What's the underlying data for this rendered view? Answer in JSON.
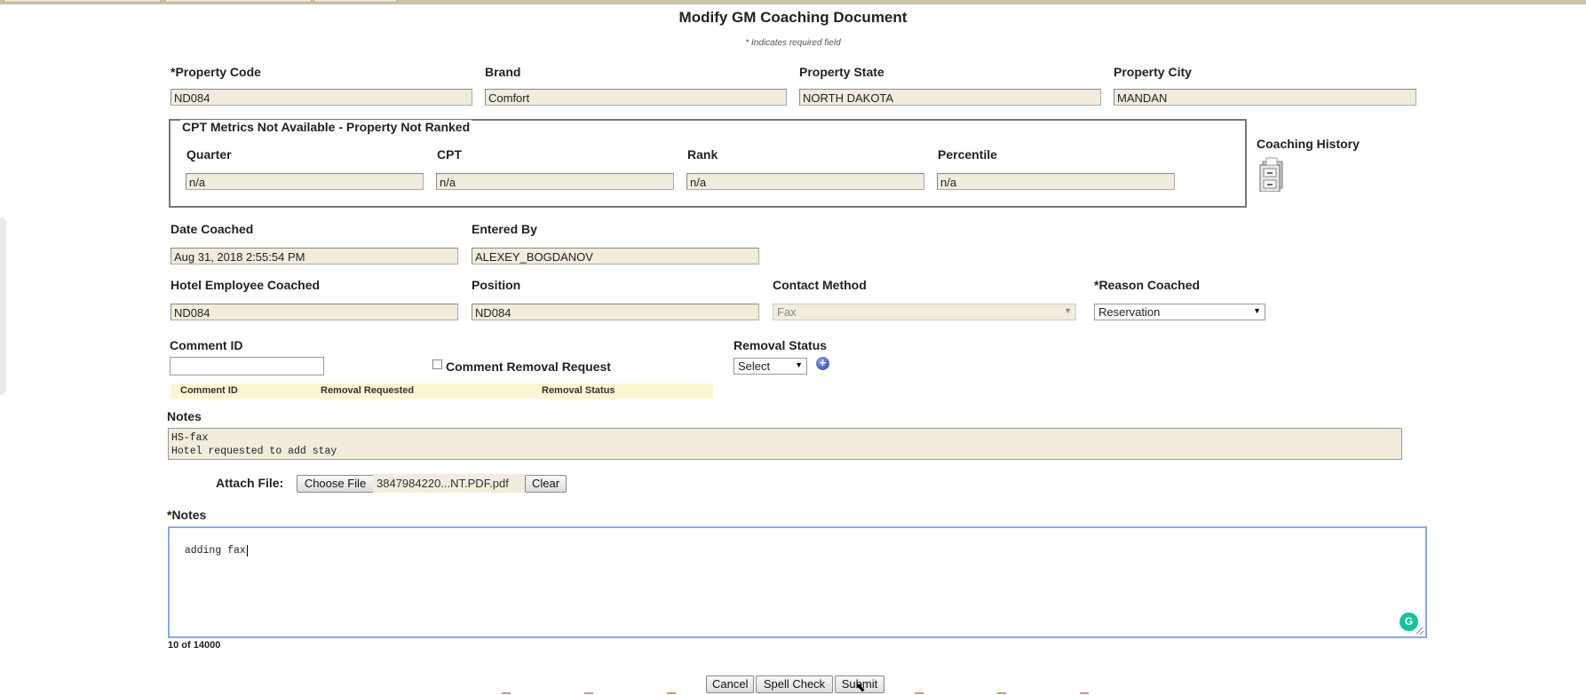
{
  "page": {
    "title": "Modify GM Coaching Document",
    "required_note": "* Indicates required field"
  },
  "property": {
    "code_label": "*Property Code",
    "code_value": "ND084",
    "brand_label": "Brand",
    "brand_value": "Comfort",
    "state_label": "Property State",
    "state_value": "NORTH DAKOTA",
    "city_label": "Property City",
    "city_value": "MANDAN"
  },
  "cpt": {
    "legend": "CPT Metrics Not Available - Property Not Ranked",
    "quarter_label": "Quarter",
    "quarter_value": "n/a",
    "cpt_label": "CPT",
    "cpt_value": "n/a",
    "rank_label": "Rank",
    "rank_value": "n/a",
    "percentile_label": "Percentile",
    "percentile_value": "n/a"
  },
  "coaching_history": {
    "label": "Coaching History",
    "icon": "file-cabinet-icon"
  },
  "coaching": {
    "date_label": "Date Coached",
    "date_value": "Aug 31, 2018 2:55:54 PM",
    "entered_label": "Entered By",
    "entered_value": "ALEXEY_BOGDANOV",
    "employee_label": "Hotel Employee Coached",
    "employee_value": "ND084",
    "position_label": "Position",
    "position_value": "ND084",
    "contact_label": "Contact Method",
    "contact_value": "Fax",
    "reason_label": "*Reason Coached",
    "reason_value": "Reservation"
  },
  "comment": {
    "id_label": "Comment ID",
    "id_value": "",
    "removal_request_label": "Comment Removal Request",
    "removal_status_label": "Removal Status",
    "removal_status_value": "Select",
    "table_headers": [
      "Comment ID",
      "Removal Requested",
      "Removal Status"
    ]
  },
  "notes_history": {
    "label": "Notes",
    "text": "HS-fax\nHotel requested to add stay"
  },
  "attach": {
    "label": "Attach File:",
    "choose_label": "Choose File",
    "filename": "3847984220...NT.PDF.pdf",
    "clear_label": "Clear"
  },
  "notes_new": {
    "label": "*Notes",
    "text": "adding fax",
    "counter": "10 of 14000"
  },
  "actions": {
    "cancel": "Cancel",
    "spell_check": "Spell Check",
    "submit": "Submit"
  },
  "colors": {
    "readonly_field": "#f1ecdb",
    "focus_border": "#88a8e6",
    "table_header_bg": "#fbf6d2",
    "grammarly": "#15c39a"
  }
}
